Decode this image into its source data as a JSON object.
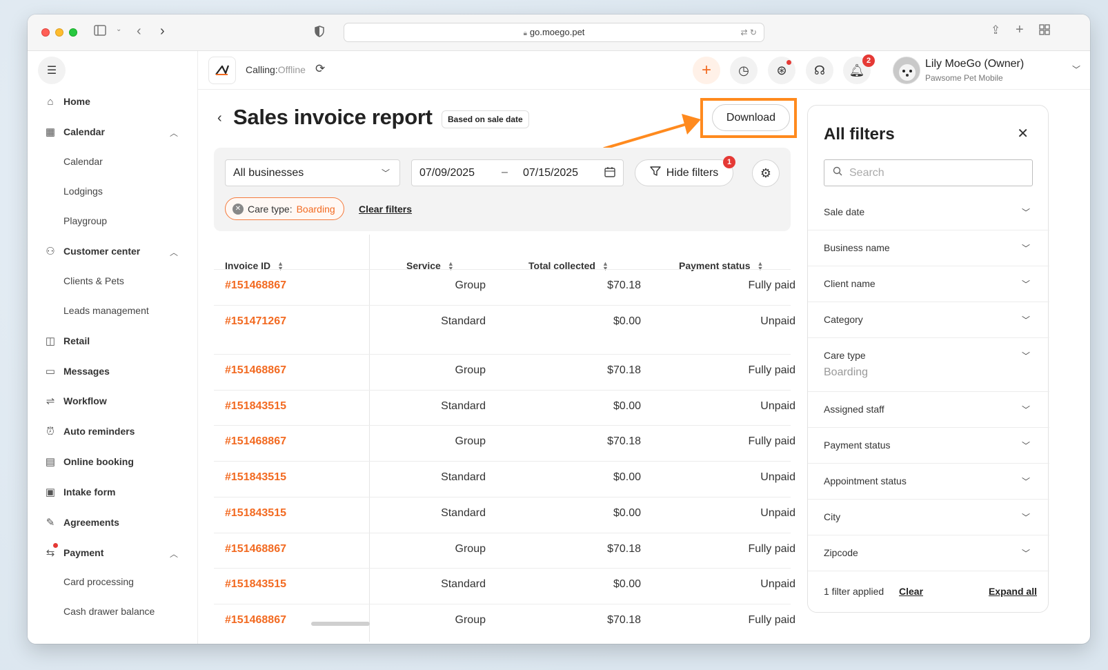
{
  "browser": {
    "url": "go.moego.pet"
  },
  "sidebar": {
    "items": [
      {
        "label": "Home"
      },
      {
        "label": "Calendar"
      },
      {
        "label": "Calendar"
      },
      {
        "label": "Lodgings"
      },
      {
        "label": "Playgroup"
      },
      {
        "label": "Customer center"
      },
      {
        "label": "Clients & Pets"
      },
      {
        "label": "Leads management"
      },
      {
        "label": "Retail"
      },
      {
        "label": "Messages"
      },
      {
        "label": "Workflow"
      },
      {
        "label": "Auto reminders"
      },
      {
        "label": "Online booking"
      },
      {
        "label": "Intake form"
      },
      {
        "label": "Agreements"
      },
      {
        "label": "Payment"
      },
      {
        "label": "Card processing"
      },
      {
        "label": "Cash drawer balance"
      }
    ]
  },
  "topbar": {
    "calling_label": "Calling:",
    "calling_status": "Offline",
    "notifications_count": "2",
    "user_name": "Lily MoeGo (Owner)",
    "business_name": "Pawsome Pet Mobile"
  },
  "page": {
    "title": "Sales invoice report",
    "badge": "Based on sale date",
    "download_label": "Download"
  },
  "filters_bar": {
    "business_select": "All businesses",
    "date_from": "07/09/2025",
    "date_sep": "–",
    "date_to": "07/15/2025",
    "hide_filters_label": "Hide filters",
    "hide_filters_count": "1",
    "chip_label": "Care type:",
    "chip_value": "Boarding",
    "clear_filters_label": "Clear filters"
  },
  "table": {
    "headers": [
      "Invoice ID",
      "Service",
      "Total collected",
      "Payment status"
    ],
    "rows": [
      {
        "id": "#151468867",
        "service": "Group",
        "total": "$70.18",
        "status": "Fully paid"
      },
      {
        "id": "#151471267",
        "service": "Standard",
        "total": "$0.00",
        "status": "Unpaid"
      },
      {
        "id": "#151468867",
        "service": "Group",
        "total": "$70.18",
        "status": "Fully paid"
      },
      {
        "id": "#151843515",
        "service": "Standard",
        "total": "$0.00",
        "status": "Unpaid"
      },
      {
        "id": "#151468867",
        "service": "Group",
        "total": "$70.18",
        "status": "Fully paid"
      },
      {
        "id": "#151843515",
        "service": "Standard",
        "total": "$0.00",
        "status": "Unpaid"
      },
      {
        "id": "#151843515",
        "service": "Standard",
        "total": "$0.00",
        "status": "Unpaid"
      },
      {
        "id": "#151468867",
        "service": "Group",
        "total": "$70.18",
        "status": "Fully paid"
      },
      {
        "id": "#151843515",
        "service": "Standard",
        "total": "$0.00",
        "status": "Unpaid"
      },
      {
        "id": "#151468867",
        "service": "Group",
        "total": "$70.18",
        "status": "Fully paid"
      }
    ]
  },
  "filters_panel": {
    "title": "All filters",
    "search_placeholder": "Search",
    "items": [
      {
        "label": "Sale date"
      },
      {
        "label": "Business name"
      },
      {
        "label": "Client name"
      },
      {
        "label": "Category"
      },
      {
        "label": "Care type",
        "value": "Boarding"
      },
      {
        "label": "Assigned staff"
      },
      {
        "label": "Payment status"
      },
      {
        "label": "Appointment status"
      },
      {
        "label": "City"
      },
      {
        "label": "Zipcode"
      }
    ],
    "applied_text": "1 filter applied",
    "clear_label": "Clear",
    "expand_label": "Expand all"
  },
  "colors": {
    "accent_orange": "#f26a21",
    "highlight_orange": "#ff8a1e",
    "badge_red": "#e53935"
  }
}
